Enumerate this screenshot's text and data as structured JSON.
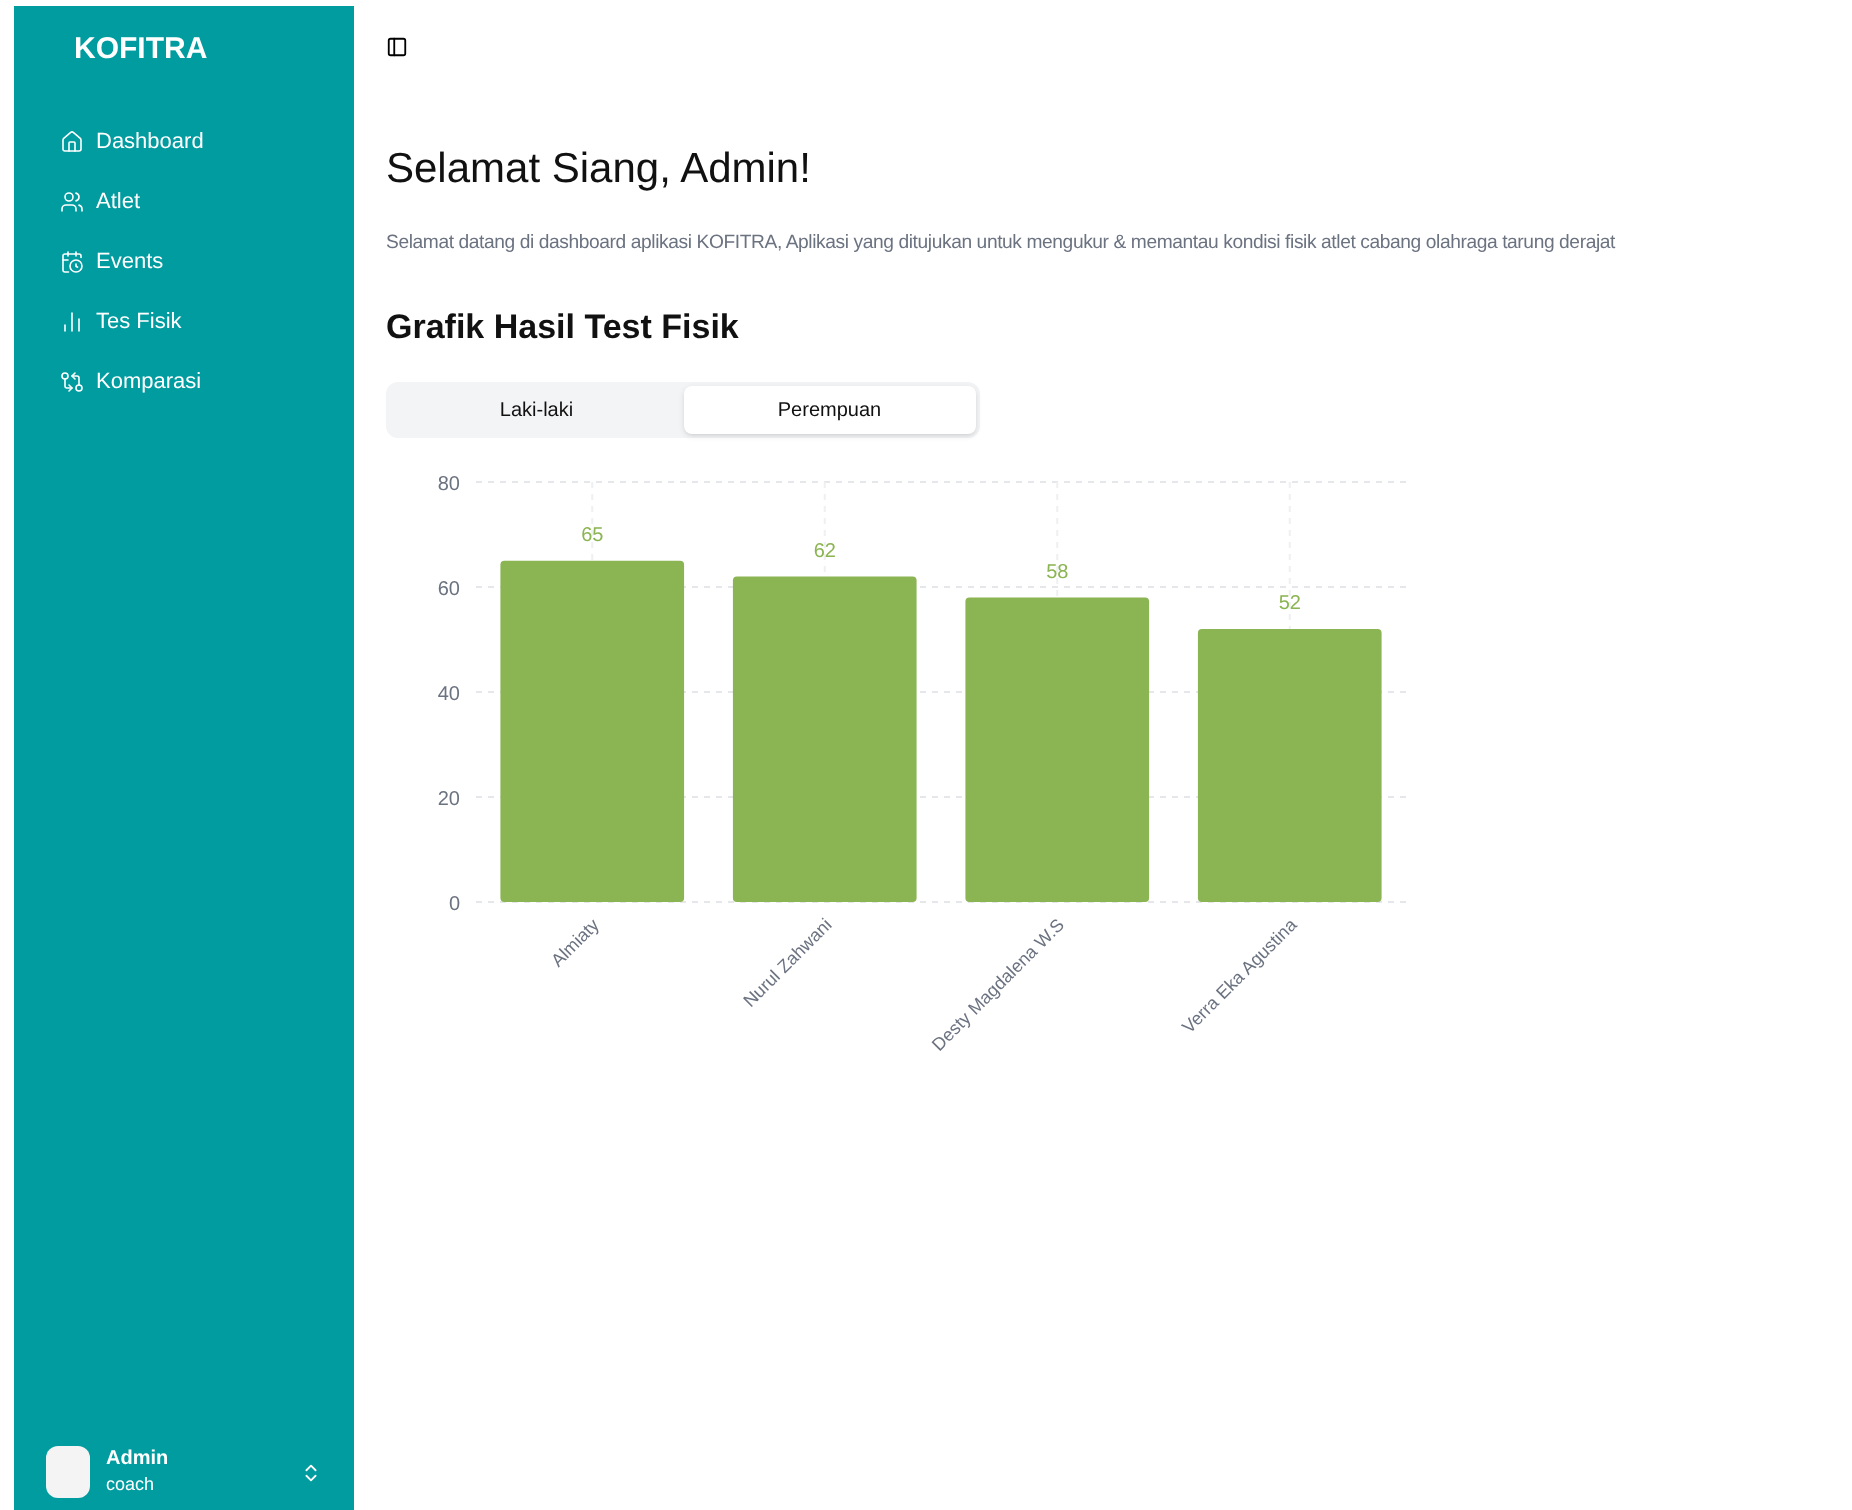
{
  "sidebar": {
    "brand": "KOFITRA",
    "items": [
      {
        "label": "Dashboard"
      },
      {
        "label": "Atlet"
      },
      {
        "label": "Events"
      },
      {
        "label": "Tes Fisik"
      },
      {
        "label": "Komparasi"
      }
    ],
    "user": {
      "name": "Admin",
      "role": "coach"
    }
  },
  "greeting": "Selamat Siang, Admin!",
  "description": "Selamat datang di dashboard aplikasi KOFITRA, Aplikasi yang ditujukan untuk mengukur & memantau kondisi fisik atlet cabang olahraga tarung derajat",
  "section_title": "Grafik Hasil Test Fisik",
  "tabs": [
    {
      "label": "Laki-laki",
      "selected": false
    },
    {
      "label": "Perempuan",
      "selected": true
    }
  ],
  "chart_data": {
    "type": "bar",
    "categories": [
      "Almiaty",
      "Nurul Zahwani",
      "Desty Magdalena W.S",
      "Verra Eka Agustina"
    ],
    "series": [
      {
        "color": "#8bb452",
        "values": [
          65,
          62,
          58,
          52
        ]
      }
    ],
    "ylim": [
      0,
      80
    ],
    "yticks": [
      0,
      20,
      40,
      60,
      80
    ],
    "grid": true,
    "data_labels": true
  }
}
